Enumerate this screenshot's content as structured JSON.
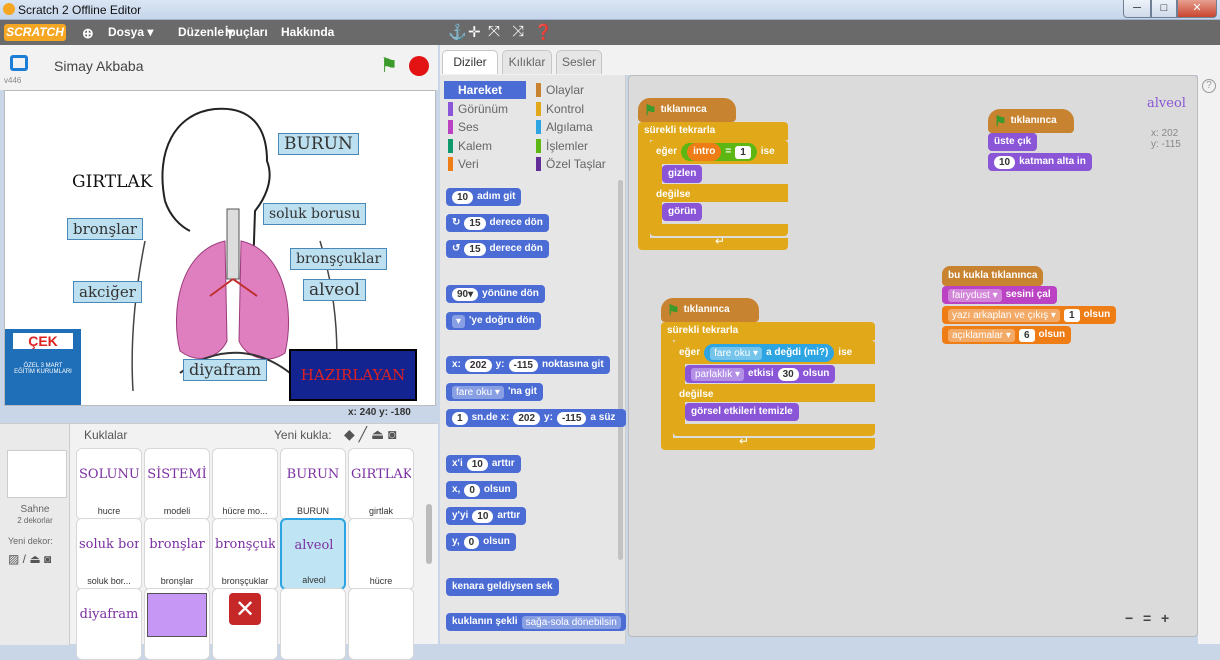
{
  "window": {
    "title": "Scratch 2 Offline Editor",
    "min": "─",
    "max": "□",
    "close": "✕"
  },
  "menu": {
    "logo": "SCRATCH",
    "file": "Dosya ▾",
    "edit": "Düzenle ▾",
    "tips": "İpuçları",
    "about": "Hakkında"
  },
  "stage": {
    "project_title": "Simay Akbaba",
    "version": "v446",
    "coords": "x: 240  y: -180"
  },
  "stage_labels": [
    "BURUN",
    "GIRTLAK",
    "soluk borusu",
    "bronşlar",
    "bronşçuklar",
    "akciğer",
    "alveol",
    "diyafram"
  ],
  "stage_button": "HAZIRLAYAN",
  "logo": {
    "title": "ÇEK",
    "line1": "ÖZEL 3 MART",
    "line2": "EĞİTİM KURUMLARI"
  },
  "sprites": {
    "title": "Kuklalar",
    "new_sprite": "Yeni kukla:",
    "stage_label": "Sahne",
    "stage_sub": "2 dekorlar",
    "new_backdrop": "Yeni dekor:",
    "items": [
      {
        "pic": "SOLUNUM",
        "name": "hucre"
      },
      {
        "pic": "SİSTEMİ",
        "name": "modeli"
      },
      {
        "pic": "",
        "name": "hücre mo..."
      },
      {
        "pic": "BURUN",
        "name": "BURUN"
      },
      {
        "pic": "GIRTLAK",
        "name": "girtlak"
      },
      {
        "pic": "soluk borusu",
        "name": "soluk bor..."
      },
      {
        "pic": "bronşlar",
        "name": "bronşlar"
      },
      {
        "pic": "bronşçuklar",
        "name": "bronşçuklar"
      },
      {
        "pic": "alveol",
        "name": "alveol"
      },
      {
        "pic": "",
        "name": "hücre"
      },
      {
        "pic": "diyafram",
        "name": ""
      },
      {
        "pic": "",
        "name": ""
      },
      {
        "pic": "✕",
        "name": ""
      },
      {
        "pic": "",
        "name": ""
      },
      {
        "pic": "",
        "name": ""
      }
    ]
  },
  "tabs": [
    "Diziler",
    "Kılıklar",
    "Sesler"
  ],
  "categories": [
    [
      "Hareket",
      "#4a6cd4"
    ],
    [
      "Olaylar",
      "#c88330"
    ],
    [
      "Görünüm",
      "#8a55d7"
    ],
    [
      "Kontrol",
      "#e1a91a"
    ],
    [
      "Ses",
      "#bb42c3"
    ],
    [
      "Algılama",
      "#2ca5e2"
    ],
    [
      "Kalem",
      "#0e9a6c"
    ],
    [
      "İşlemler",
      "#5cb712"
    ],
    [
      "Veri",
      "#ee7d16"
    ],
    [
      "Özel Taşlar",
      "#632d99"
    ]
  ],
  "palette": {
    "move": [
      "10",
      "adım git"
    ],
    "turn_r": [
      "15",
      "derece dön"
    ],
    "turn_l": [
      "15",
      "derece dön"
    ],
    "point": [
      "90▾",
      "yönüne dön"
    ],
    "toward": [
      "▾",
      "'ye doğru dön"
    ],
    "goto_xy": [
      "x:",
      "202",
      "y:",
      "-115",
      "noktasına git"
    ],
    "goto": [
      "fare oku ▾",
      "'na git"
    ],
    "glide": [
      "1",
      "sn.de x:",
      "202",
      "y:",
      "-115",
      "a süz"
    ],
    "chx": [
      "x'i",
      "10",
      "arttır"
    ],
    "setx": [
      "x,",
      "0",
      "olsun"
    ],
    "chy": [
      "y'yi",
      "10",
      "arttır"
    ],
    "sety": [
      "y,",
      "0",
      "olsun"
    ],
    "bounce": "kenara geldiysen sek",
    "rot": [
      "kuklanın şekli",
      "sağa-sola dönebilsin"
    ]
  },
  "scripts": {
    "s1": {
      "hat": "tıklanınca",
      "forever": "sürekli tekrarla",
      "if": "eğer",
      "var": "intro",
      "eq": "=",
      "val": "1",
      "ise": "ise",
      "hide": "gizlen",
      "else": "değilse",
      "show": "görün"
    },
    "s2": {
      "hat": "tıklanınca",
      "forever": "sürekli tekrarla",
      "if": "eğer",
      "sensor": "fare oku ▾",
      "touch": "a değdi (mi?)",
      "ise": "ise",
      "eff": "parlaklık ▾",
      "eff2": "etkisi",
      "effv": "30",
      "eff3": "olsun",
      "else": "değilse",
      "clear": "görsel etkileri temizle"
    },
    "s3": {
      "hat": "tıklanınca",
      "front": "üste çık",
      "layer_v": "10",
      "layer": "katman alta in"
    },
    "s4": {
      "hat": "bu kukla tıklanınca",
      "snd": "fairydust ▾",
      "snd2": "sesini çal",
      "var1": "yazı arkaplan ve çıkış ▾",
      "v1": "1",
      "olsun": "olsun",
      "var2": "açıklamalar ▾",
      "v2": "6"
    },
    "sprite_name": "alveol",
    "sx": "x: 202",
    "sy": "y: -115"
  },
  "zoom": {
    "out": "−",
    "reset": "=",
    "in": "+"
  }
}
